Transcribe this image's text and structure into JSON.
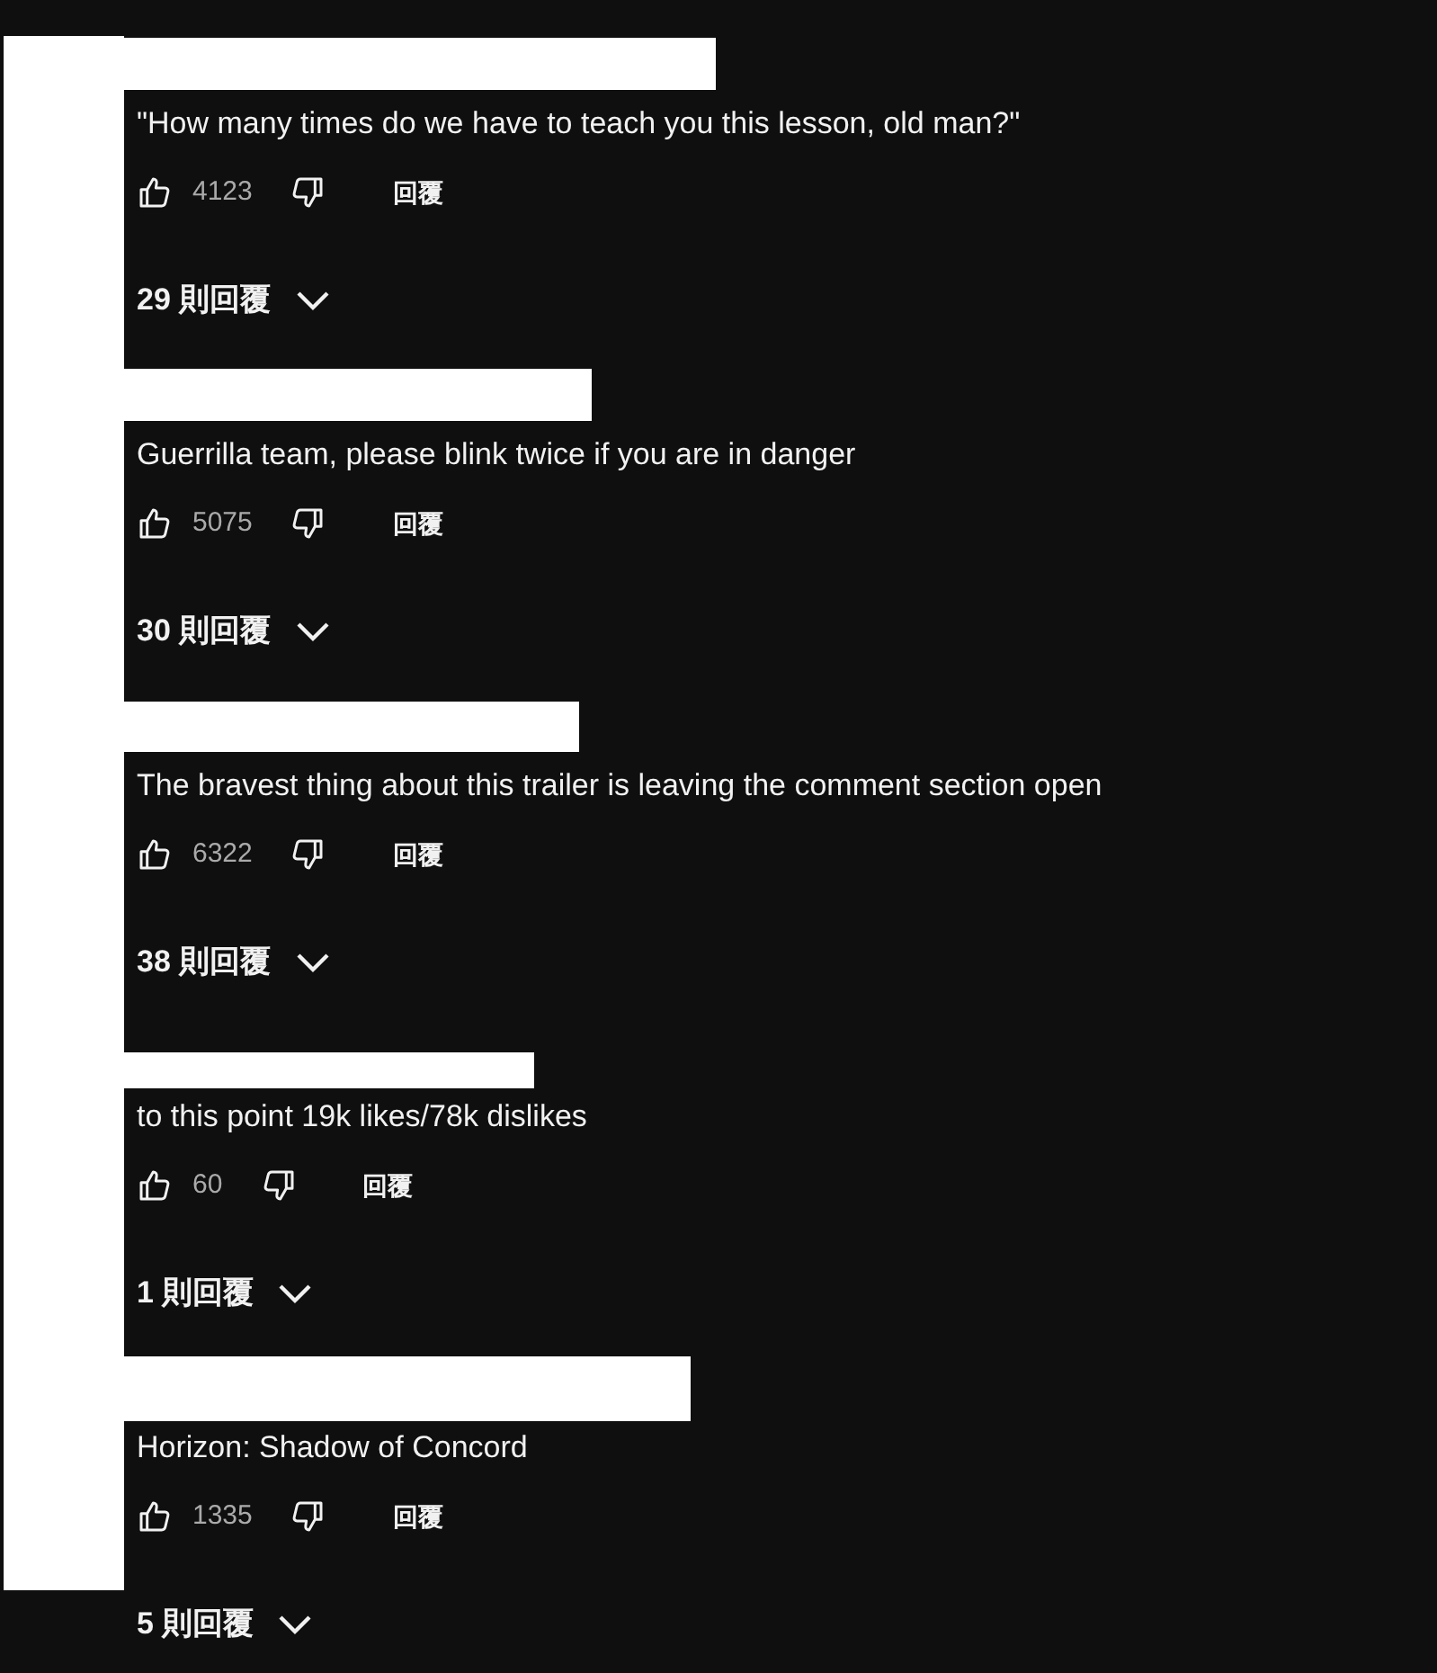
{
  "comments": [
    {
      "text": "\"How many times do we have to teach you this lesson, old man?\"",
      "likes": "4123",
      "reply_label": "回覆",
      "replies": "29 則回覆"
    },
    {
      "text": "Guerrilla team, please blink twice if you are in danger",
      "likes": "5075",
      "reply_label": "回覆",
      "replies": "30 則回覆"
    },
    {
      "text": "The bravest thing about this trailer is leaving the comment section open",
      "likes": "6322",
      "reply_label": "回覆",
      "replies": "38 則回覆"
    },
    {
      "text": "to this point 19k likes/78k dislikes",
      "likes": "60",
      "reply_label": "回覆",
      "replies": "1 則回覆"
    },
    {
      "text": "Horizon: Shadow of Concord",
      "likes": "1335",
      "reply_label": "回覆",
      "replies": "5 則回覆"
    }
  ]
}
